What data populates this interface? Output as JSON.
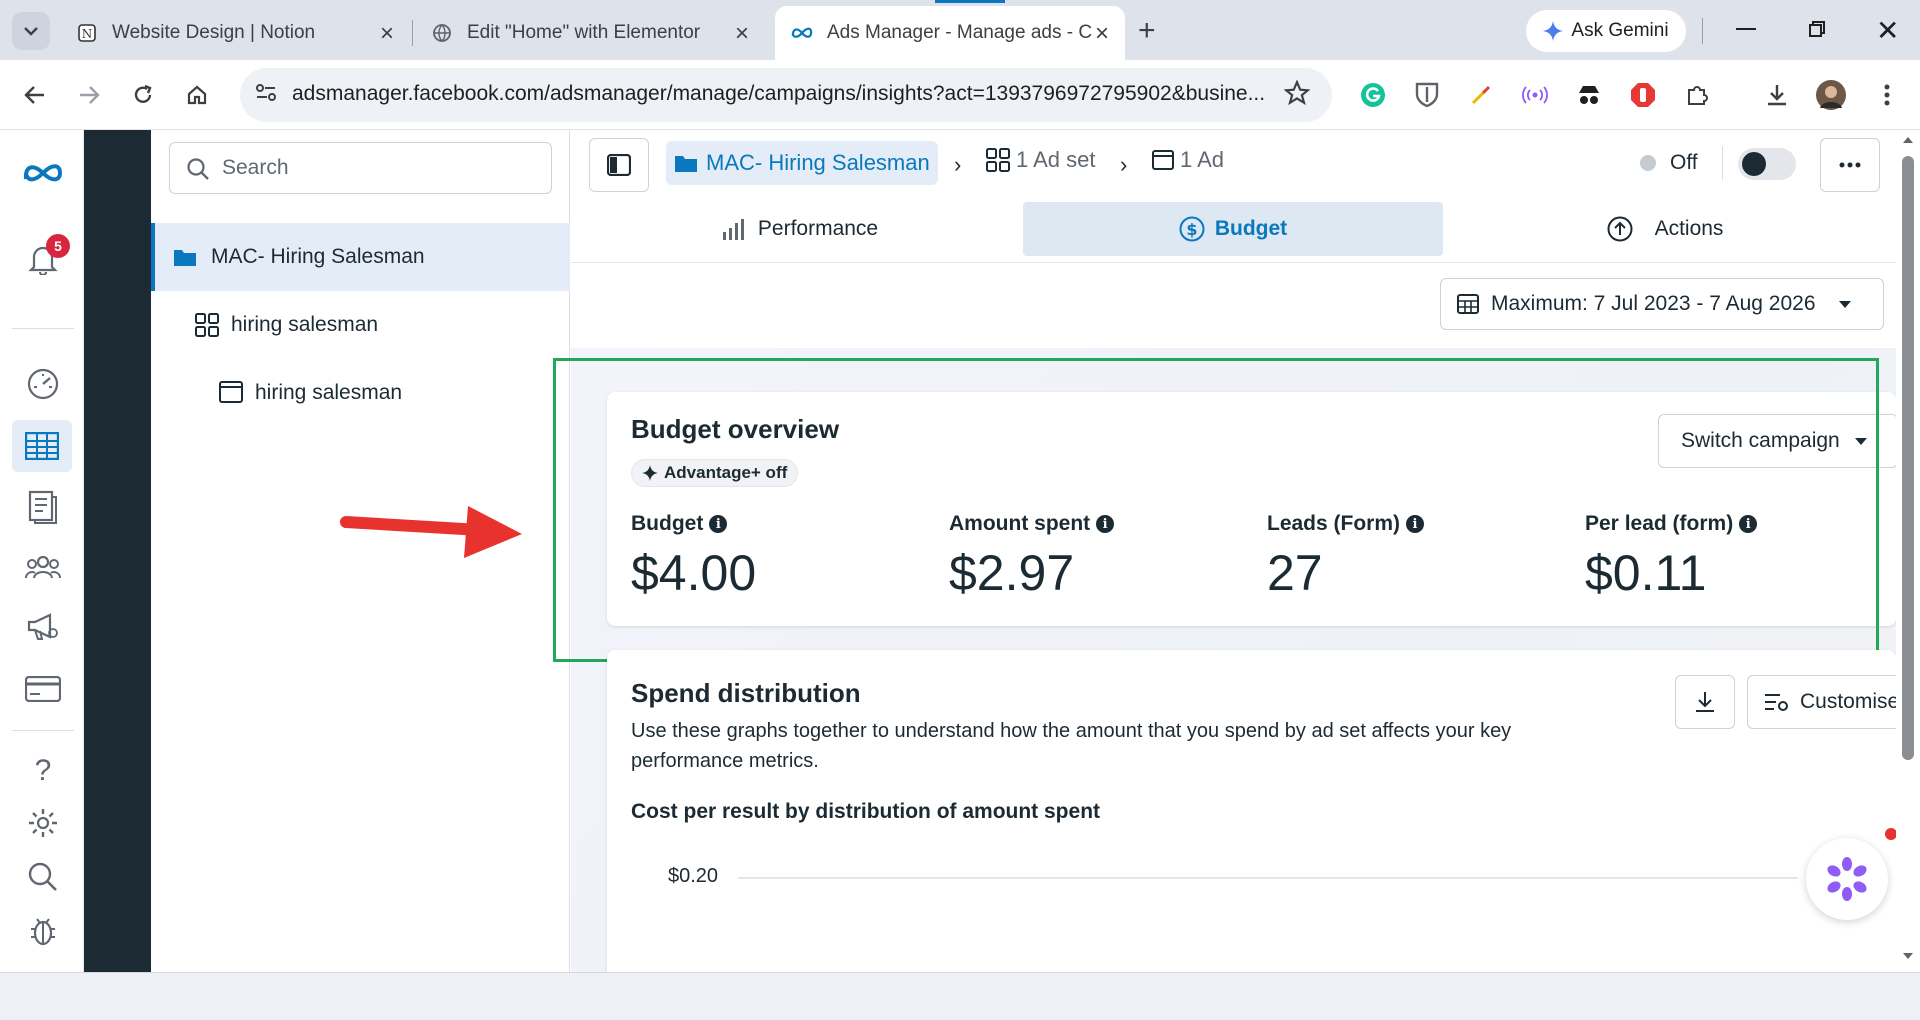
{
  "browser": {
    "tabs": [
      {
        "title": "Website Design | Notion",
        "active": false
      },
      {
        "title": "Edit \"Home\" with Elementor",
        "active": false
      },
      {
        "title": "Ads Manager - Manage ads - C",
        "active": true
      }
    ],
    "ask_gemini": "Ask Gemini",
    "url": "adsmanager.facebook.com/adsmanager/manage/campaigns/insights?act=1393796972795902&busine..."
  },
  "rail": {
    "notification_count": "5"
  },
  "tree": {
    "search_placeholder": "Search",
    "items": [
      {
        "label": "MAC- Hiring Salesman",
        "type": "campaign"
      },
      {
        "label": "hiring salesman",
        "type": "adset"
      },
      {
        "label": "hiring salesman",
        "type": "ad"
      }
    ]
  },
  "header": {
    "breadcrumb_campaign": "MAC- Hiring Salesman",
    "breadcrumb_adset": "1 Ad set",
    "breadcrumb_ad": "1 Ad",
    "status": "Off"
  },
  "tabs": {
    "performance": "Performance",
    "budget": "Budget",
    "actions": "Actions"
  },
  "date_range": "Maximum: 7 Jul 2023 - 7 Aug 2026",
  "budget_overview": {
    "title": "Budget overview",
    "advantage_badge": "Advantage+ off",
    "switch_button": "Switch campaign",
    "metrics": [
      {
        "label": "Budget",
        "value": "$4.00"
      },
      {
        "label": "Amount spent",
        "value": "$2.97"
      },
      {
        "label": "Leads (Form)",
        "value": "27"
      },
      {
        "label": "Per lead (form)",
        "value": "$0.11"
      }
    ]
  },
  "spend_distribution": {
    "title": "Spend distribution",
    "customise_button": "Customise",
    "description": "Use these graphs together to understand how the amount that you spend by ad set affects your key performance metrics.",
    "chart_title": "Cost per result by distribution of amount spent",
    "y_tick": "$0.20"
  },
  "colors": {
    "accent": "#0a78be",
    "highlight": "#22a85a",
    "arrow": "#e8322d",
    "dark_rail": "#1c2b33",
    "badge": "#d7263d"
  }
}
